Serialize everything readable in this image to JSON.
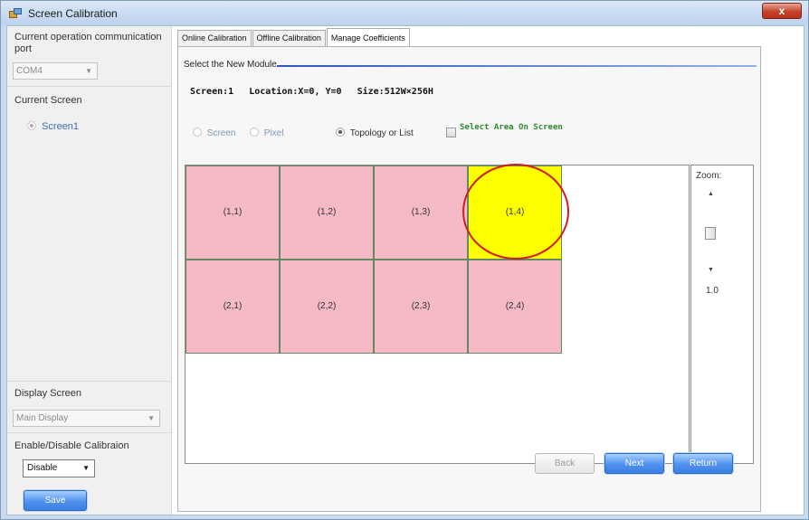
{
  "window": {
    "title": "Screen Calibration",
    "close_glyph": "x"
  },
  "left": {
    "comm_port_label": "Current operation communication port",
    "comm_port_value": "COM4",
    "current_screen_label": "Current Screen",
    "screen_option": "Screen1",
    "display_screen_label": "Display Screen",
    "display_value": "Main Display",
    "enable_label": "Enable/Disable Calibraion",
    "enable_value": "Disable",
    "save_label": "Save"
  },
  "tabs": [
    "Online Calibration",
    "Offline Calibration",
    "Manage Coefficients"
  ],
  "active_tab": "Manage Coefficients",
  "module": {
    "section_title": "Select the New Module",
    "screen": "Screen:1",
    "location": "Location:X=0, Y=0",
    "size": "Size:512W×256H",
    "opt_screen": "Screen",
    "opt_pixel": "Pixel",
    "opt_topology": "Topology or List",
    "select_area": "Select Area On Screen"
  },
  "grid": {
    "rows": [
      [
        "(1,1)",
        "(1,2)",
        "(1,3)",
        "(1,4)"
      ],
      [
        "(2,1)",
        "(2,2)",
        "(2,3)",
        "(2,4)"
      ]
    ],
    "highlighted": "(1,4)",
    "cell_color": "#f6bac7",
    "highlight_color": "#ffff00",
    "circle_color": "#d21d1d"
  },
  "zoom": {
    "label": "Zoom:",
    "value": "1.0"
  },
  "buttons": {
    "back": "Back",
    "next": "Next",
    "return": "Return"
  }
}
